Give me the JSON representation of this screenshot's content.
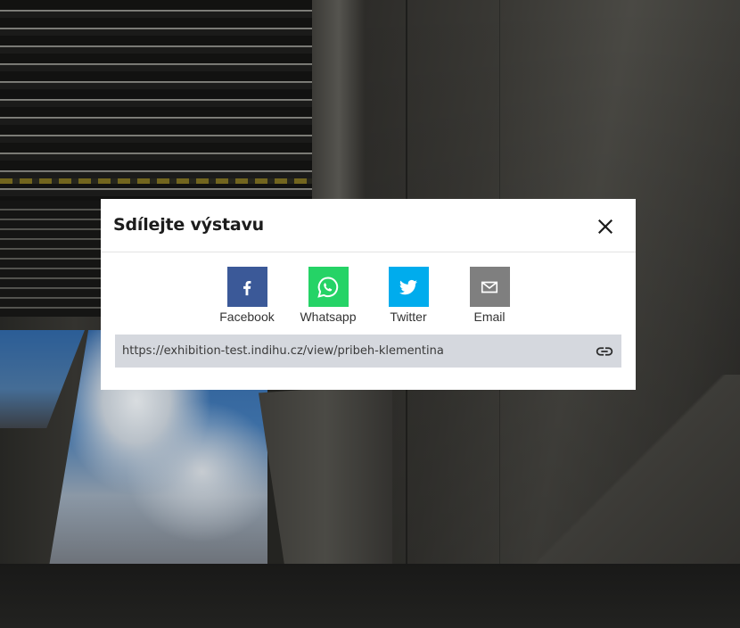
{
  "modal": {
    "title": "Sdílejte výstavu",
    "close_icon": "close-icon"
  },
  "share": {
    "items": [
      {
        "label": "Facebook",
        "icon": "facebook-icon",
        "color": "#3b5998"
      },
      {
        "label": "Whatsapp",
        "icon": "whatsapp-icon",
        "color": "#25d366"
      },
      {
        "label": "Twitter",
        "icon": "twitter-icon",
        "color": "#00aced"
      },
      {
        "label": "Email",
        "icon": "email-icon",
        "color": "#7f7f7f"
      }
    ]
  },
  "link": {
    "url": "https://exhibition-test.indihu.cz/view/pribeh-klementina",
    "icon": "link-icon",
    "background": "#d5d8de"
  }
}
